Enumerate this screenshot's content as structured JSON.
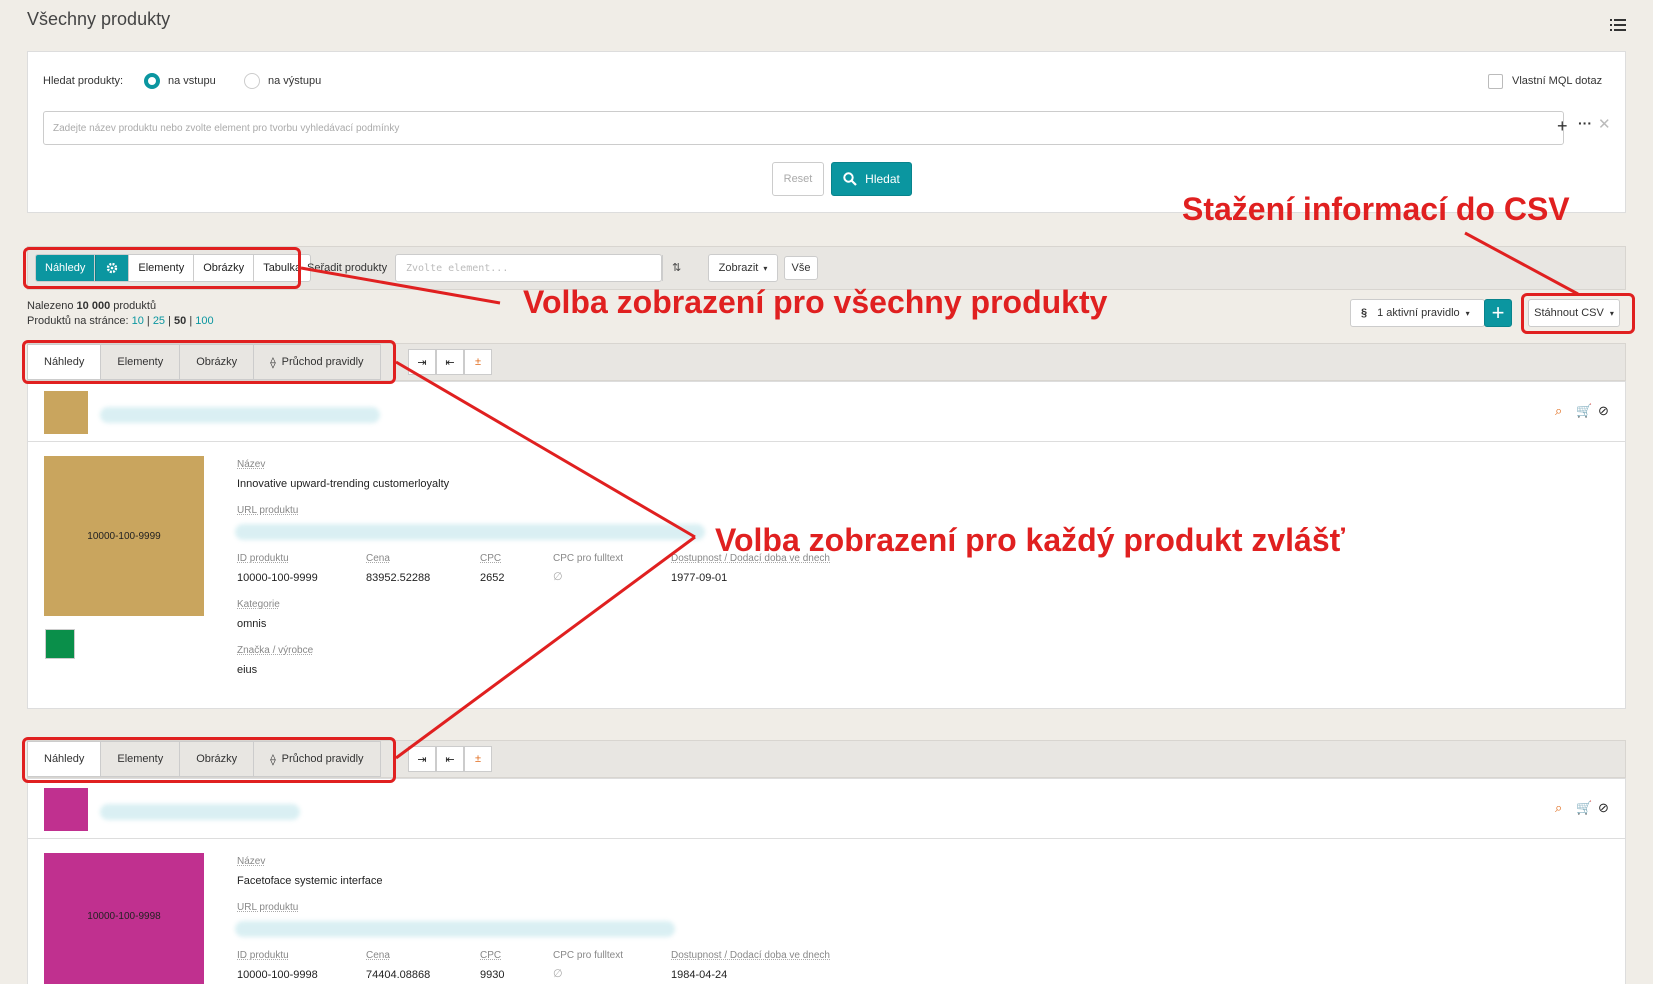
{
  "page": {
    "title": "Všechny produkty"
  },
  "search": {
    "label": "Hledat produkty:",
    "radio_input": "na vstupu",
    "radio_output": "na výstupu",
    "mql_label": "Vlastní MQL dotaz",
    "placeholder": "Zadejte název produktu nebo zvolte element pro tvorbu vyhledávací podmínky",
    "reset_label": "Reset",
    "search_label": "Hledat"
  },
  "toolbar": {
    "views": [
      "Náhledy",
      "Elementy",
      "Obrázky",
      "Tabulka"
    ],
    "sort_label": "Seřadit produkty",
    "sort_placeholder": "Zvolte element...",
    "show_label": "Zobrazit",
    "all_label": "Vše"
  },
  "results": {
    "found_prefix": "Nalezeno",
    "found_count": "10 000",
    "found_suffix": "produktů",
    "per_page_label": "Produktů na stránce:",
    "per_page": [
      "10",
      "25",
      "50",
      "100"
    ],
    "sep": "|"
  },
  "rules": {
    "symbol": "§",
    "active_label": "1 aktivní pravidlo",
    "download_label": "Stáhnout CSV"
  },
  "product_tabs": [
    "Náhledy",
    "Elementy",
    "Obrázky",
    "Průchod pravidly"
  ],
  "fields": {
    "name": "Název",
    "url": "URL produktu",
    "id": "ID produktu",
    "price": "Cena",
    "cpc": "CPC",
    "cpc_fulltext": "CPC pro fulltext",
    "availability": "Dostupnost / Dodací doba ve dnech",
    "category": "Kategorie",
    "brand": "Značka / výrobce",
    "empty": "∅"
  },
  "products": [
    {
      "name": "Innovative upward-trending customerloyalty",
      "id": "10000-100-9999",
      "price": "83952.52288",
      "cpc": "2652",
      "availability": "1977-09-01",
      "category": "omnis",
      "brand": "eius",
      "color": "#c9a55e",
      "swatch": "#0a8f4a"
    },
    {
      "name": "Facetoface systemic interface",
      "id": "10000-100-9998",
      "price": "74404.08868",
      "cpc": "9930",
      "availability": "1984-04-24",
      "color": "#c0308f"
    }
  ],
  "annotations": {
    "csv": "Stažení informací do CSV",
    "all_products": "Volba zobrazení pro všechny produkty",
    "each_product": "Volba zobrazení pro každý produkt zvlášť"
  },
  "colors": {
    "accent": "#0b96a0",
    "annotation": "#e02020"
  }
}
